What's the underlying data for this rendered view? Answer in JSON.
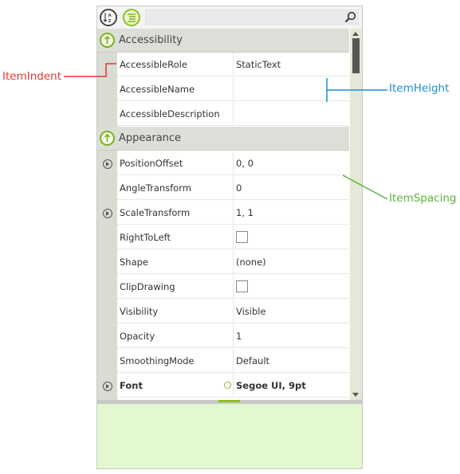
{
  "colors": {
    "accent_green": "#8cbf1f",
    "category_bg": "#dcdfd7",
    "description_bg": "#e2f8d0",
    "annotation_red": "#e03a3a",
    "annotation_blue": "#1a8fd4",
    "annotation_green": "#58b43a"
  },
  "toolbar": {
    "sort_icon": "sort-alphabetical-icon",
    "categorize_icon": "categorized-icon",
    "search_placeholder": "",
    "search_icon": "search-icon"
  },
  "categories": {
    "accessibility": {
      "label": "Accessibility",
      "rows": [
        {
          "name": "AccessibleRole",
          "value": "StaticText"
        },
        {
          "name": "AccessibleName",
          "value": ""
        },
        {
          "name": "AccessibleDescription",
          "value": ""
        }
      ]
    },
    "appearance": {
      "label": "Appearance",
      "rows": [
        {
          "name": "PositionOffset",
          "value": "0, 0",
          "expandable": true
        },
        {
          "name": "AngleTransform",
          "value": "0"
        },
        {
          "name": "ScaleTransform",
          "value": "1, 1",
          "expandable": true
        },
        {
          "name": "RightToLeft",
          "value": "",
          "checkbox": true
        },
        {
          "name": "Shape",
          "value": "(none)"
        },
        {
          "name": "ClipDrawing",
          "value": "",
          "checkbox": true
        },
        {
          "name": "Visibility",
          "value": "Visible"
        },
        {
          "name": "Opacity",
          "value": "1"
        },
        {
          "name": "SmoothingMode",
          "value": "Default"
        },
        {
          "name": "Font",
          "value": "Segoe UI, 9pt",
          "expandable": true,
          "bold": true
        }
      ]
    }
  },
  "annotations": {
    "item_indent": "ItemIndent",
    "item_height": "ItemHeight",
    "item_spacing": "ItemSpacing"
  }
}
